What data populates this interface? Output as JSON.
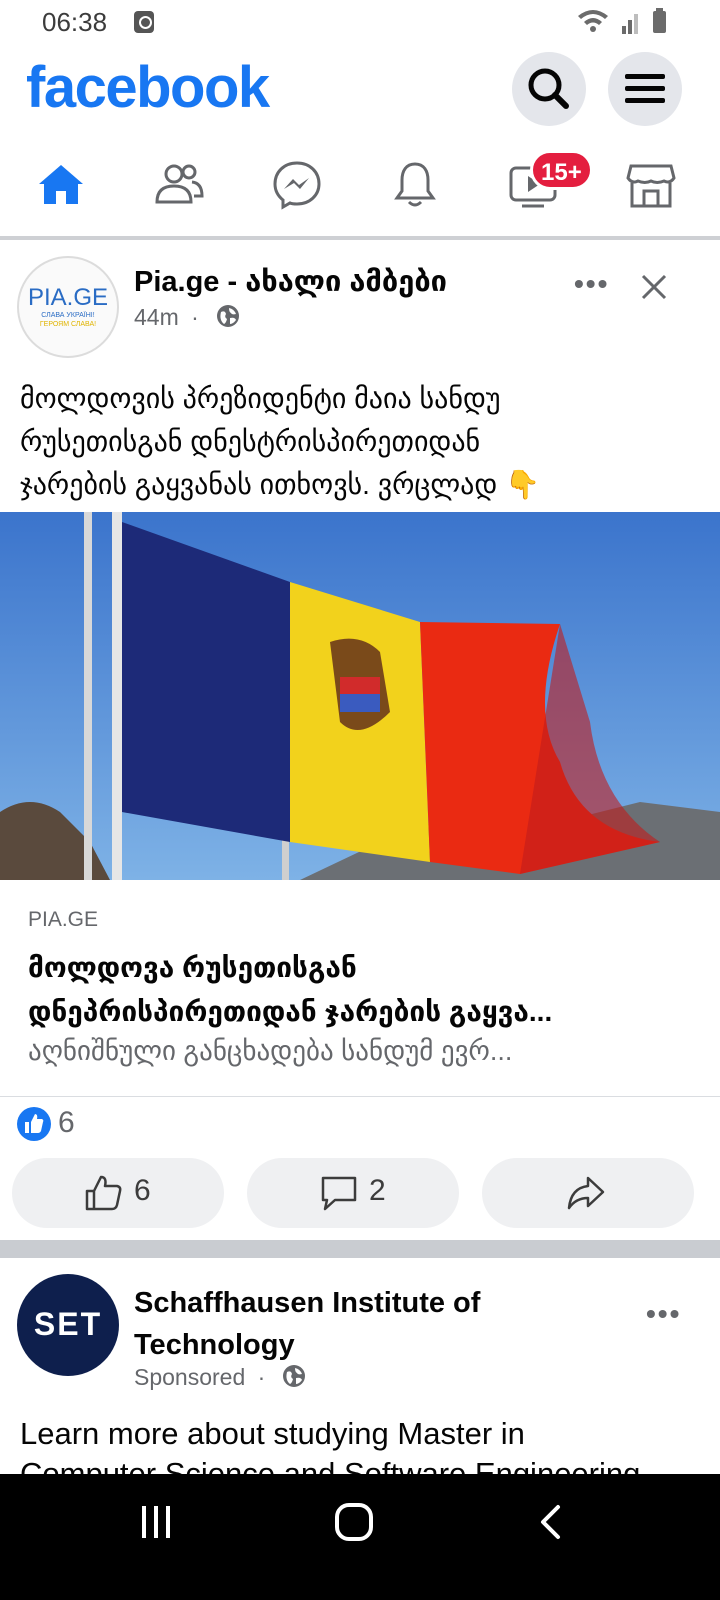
{
  "status_bar": {
    "time": "06:38"
  },
  "header": {
    "logo_text": "facebook"
  },
  "tabs": [
    {
      "name": "Home",
      "icon": "home-icon",
      "active": true
    },
    {
      "name": "Friends",
      "icon": "friends-icon"
    },
    {
      "name": "Messenger",
      "icon": "messenger-icon"
    },
    {
      "name": "Notifications",
      "icon": "bell-icon"
    },
    {
      "name": "Watch",
      "icon": "video-icon",
      "badge": "15+"
    },
    {
      "name": "Marketplace",
      "icon": "marketplace-icon"
    }
  ],
  "post1": {
    "avatar_text": "PIA.GE",
    "avatar_sub1": "СЛАВА УКРАЇНІ!",
    "avatar_sub2": "ГЕРОЯМ СЛАВА!",
    "page_name": "Pia.ge - ახალი ამბები",
    "time": "44m",
    "text_lines": [
      "მოლდოვის პრეზიდენტი მაია სანდუ",
      "რუსეთისგან დნესტრისპირეთიდან",
      "ჯარების გაყვანას ითხოვს. ვრცლად"
    ],
    "text_emoji": "👇",
    "link": {
      "domain": "PIA.GE",
      "title_line1": "მოლდოვა რუსეთისგან",
      "title_line2": "დნეპრისპირეთიდან ჯარების გაყვა...",
      "description": "აღნიშნული განცხადება სანდუმ ევრ..."
    },
    "reaction_count": "6",
    "actions": {
      "like_count": "6",
      "comment_count": "2"
    }
  },
  "post2": {
    "avatar_text": "SET",
    "page_name_line1": "Schaffhausen Institute of",
    "page_name_line2": "Technology",
    "sponsored_label": "Sponsored",
    "text_line1": "Learn more about studying Master in",
    "text_line2": "Computer Science and Software Engineering"
  },
  "colors": {
    "brand": "#1877f2",
    "badge": "#e41e3f"
  }
}
